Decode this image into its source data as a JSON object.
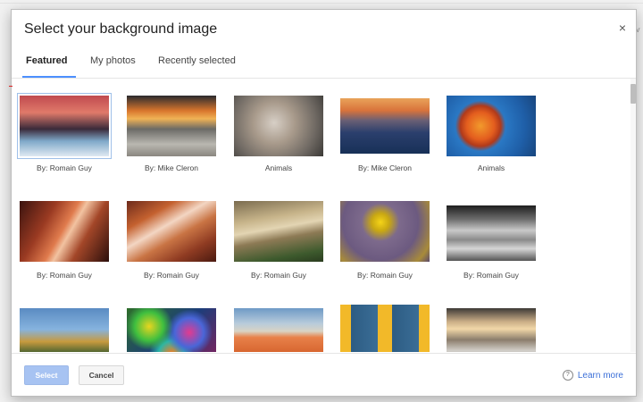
{
  "dialog": {
    "title": "Select your background image",
    "close_label": "×"
  },
  "tabs": [
    {
      "label": "Featured",
      "active": true
    },
    {
      "label": "My photos",
      "active": false
    },
    {
      "label": "Recently selected",
      "active": false
    }
  ],
  "images": [
    {
      "caption": "By: Romain Guy",
      "selected": true,
      "subject": "snowy sunset landscape"
    },
    {
      "caption": "By: Mike Cleron",
      "selected": false,
      "subject": "sunset over clouds"
    },
    {
      "caption": "Animals",
      "selected": false,
      "subject": "snow monkeys"
    },
    {
      "caption": "By: Mike Cleron",
      "selected": false,
      "subject": "dusk over mountains"
    },
    {
      "caption": "Animals",
      "selected": false,
      "subject": "jellyfish"
    },
    {
      "caption": "By: Romain Guy",
      "selected": false,
      "subject": "slot canyon"
    },
    {
      "caption": "By: Romain Guy",
      "selected": false,
      "subject": "slot canyon swirl"
    },
    {
      "caption": "By: Romain Guy",
      "selected": false,
      "subject": "wooden rail close-up"
    },
    {
      "caption": "By: Romain Guy",
      "selected": false,
      "subject": "yellow flowers with bee"
    },
    {
      "caption": "By: Romain Guy",
      "selected": false,
      "subject": "black and white lake"
    },
    {
      "caption": "",
      "selected": false,
      "subject": "autumn lake"
    },
    {
      "caption": "",
      "selected": false,
      "subject": "colorful glass"
    },
    {
      "caption": "",
      "selected": false,
      "subject": "sand dunes"
    },
    {
      "caption": "",
      "selected": false,
      "subject": "yellow wall with blue shutters"
    },
    {
      "caption": "",
      "selected": false,
      "subject": "rocky coast at sunset"
    }
  ],
  "footer": {
    "select_label": "Select",
    "cancel_label": "Cancel",
    "learn_more_label": "Learn more",
    "help_icon": "?"
  },
  "colors": {
    "accent": "#4d90fe",
    "select_button": "#a7c3f2",
    "link": "#3b6fd8"
  }
}
